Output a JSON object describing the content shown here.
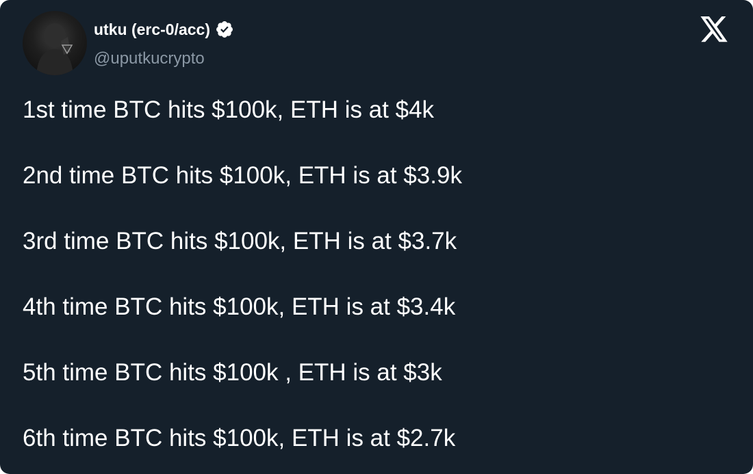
{
  "tweet": {
    "author": {
      "display_name": "utku (erc-0/acc)",
      "handle": "@uputkucrypto",
      "verified": true
    },
    "platform_icon": "x-logo-icon",
    "lines": [
      "1st time BTC hits $100k, ETH is at $4k",
      "2nd time BTC hits $100k, ETH is at $3.9k",
      "3rd time BTC hits $100k, ETH is at $3.7k",
      "4th time BTC hits $100k, ETH is at $3.4k",
      "5th time BTC hits $100k , ETH is at $3k",
      "6th time BTC hits $100k, ETH is at $2.7k"
    ]
  },
  "colors": {
    "background": "#15202b",
    "text_primary": "#ffffff",
    "text_secondary": "#8b98a5",
    "verified_badge": "#ffffff"
  }
}
